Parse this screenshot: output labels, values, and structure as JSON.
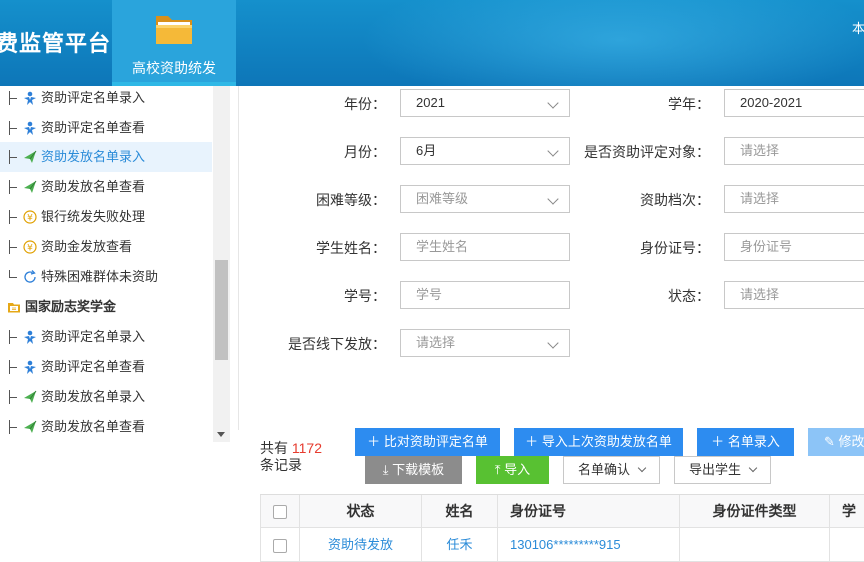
{
  "header": {
    "title": "费监管平台",
    "nav_tab": "高校资助统发",
    "right_text": "本"
  },
  "sidebar": {
    "items": [
      {
        "label": "资助评定名单录入",
        "icon": "person-star-icon"
      },
      {
        "label": "资助评定名单查看",
        "icon": "person-star-icon"
      },
      {
        "label": "资助发放名单录入",
        "icon": "send-icon",
        "active": true
      },
      {
        "label": "资助发放名单查看",
        "icon": "send-icon"
      },
      {
        "label": "银行统发失败处理",
        "icon": "yen-coin-icon"
      },
      {
        "label": "资助金发放查看",
        "icon": "yen-coin-icon"
      },
      {
        "label": "特殊困难群体未资助",
        "icon": "refresh-icon"
      },
      {
        "label": "国家励志奖学金",
        "icon": "folder-icon",
        "group": true
      },
      {
        "label": "资助评定名单录入",
        "icon": "person-star-icon"
      },
      {
        "label": "资助评定名单查看",
        "icon": "person-star-icon"
      },
      {
        "label": "资助发放名单录入",
        "icon": "send-icon"
      },
      {
        "label": "资助发放名单查看",
        "icon": "send-icon"
      }
    ]
  },
  "form": {
    "year_label": "年份：",
    "year_value": "2021",
    "school_year_label": "学年：",
    "school_year_value": "2020-2021",
    "month_label": "月份：",
    "month_value": "6月",
    "eval_target_label": "是否资助评定对象：",
    "eval_target_placeholder": "请选择",
    "difficulty_label": "困难等级：",
    "difficulty_placeholder": "困难等级",
    "grade_label": "资助档次：",
    "grade_placeholder": "请选择",
    "name_label": "学生姓名：",
    "name_placeholder": "学生姓名",
    "idcard_label": "身份证号：",
    "idcard_placeholder": "身份证号",
    "studentno_label": "学号：",
    "studentno_placeholder": "学号",
    "status_label": "状态：",
    "status_placeholder": "请选择",
    "offline_label": "是否线下发放：",
    "offline_placeholder": "请选择"
  },
  "toolbar": {
    "compare_btn": "比对资助评定名单",
    "import_last_btn": "导入上次资助发放名单",
    "entry_btn": "名单录入",
    "edit_btn": "修改",
    "download_btn": "下载模板",
    "import_btn": "导入",
    "confirm_btn": "名单确认",
    "export_btn": "导出学生"
  },
  "records": {
    "prefix": "共有 ",
    "count": "1172",
    "suffix": "条记录"
  },
  "table": {
    "columns": [
      "状态",
      "姓名",
      "身份证号",
      "身份证件类型",
      "学"
    ],
    "rows": [
      {
        "status": "资助待发放",
        "name": "任禾",
        "idcard": "130106*********915",
        "idtype": "",
        "extra": ""
      }
    ]
  },
  "colors": {
    "header_blue": "#0d76b8",
    "primary_blue": "#2d8cf0",
    "green": "#58c132",
    "count_red": "#e63b2e"
  }
}
